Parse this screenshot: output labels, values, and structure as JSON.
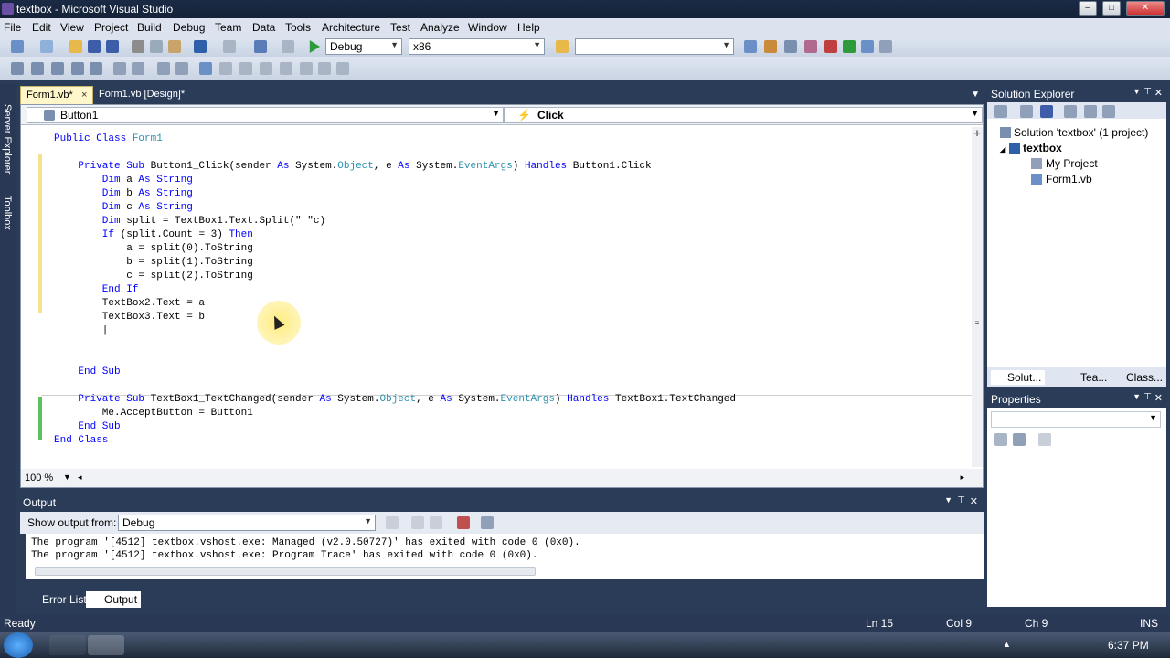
{
  "window": {
    "title": "textbox - Microsoft Visual Studio"
  },
  "menu": [
    "File",
    "Edit",
    "View",
    "Project",
    "Build",
    "Debug",
    "Team",
    "Data",
    "Tools",
    "Architecture",
    "Test",
    "Analyze",
    "Window",
    "Help"
  ],
  "toolbar": {
    "config": "Debug",
    "platform": "x86",
    "find_value": ""
  },
  "left_rail": {
    "server_explorer": "Server Explorer",
    "toolbox": "Toolbox"
  },
  "doc_tabs": [
    {
      "label": "Form1.vb*",
      "close": "×"
    },
    {
      "label": "Form1.vb [Design]*"
    }
  ],
  "editor": {
    "nav_left": "Button1",
    "nav_right": "Click",
    "zoom": "100 %",
    "lines": [
      {
        "tokens": [
          {
            "t": "Public Class ",
            "k": "kw"
          },
          {
            "t": "Form1",
            "k": "ty"
          }
        ]
      },
      {
        "tokens": [
          {
            "t": "    Private Sub ",
            "k": "kw"
          },
          {
            "t": "Button1_Click(sender "
          },
          {
            "t": "As ",
            "k": "kw"
          },
          {
            "t": "System."
          },
          {
            "t": "Object",
            "k": "ty"
          },
          {
            "t": ", e "
          },
          {
            "t": "As ",
            "k": "kw"
          },
          {
            "t": "System."
          },
          {
            "t": "EventArgs",
            "k": "ty"
          },
          {
            "t": ") "
          },
          {
            "t": "Handles ",
            "k": "kw"
          },
          {
            "t": "Button1.Click"
          }
        ]
      },
      {
        "tokens": [
          {
            "t": "        Dim ",
            "k": "kw"
          },
          {
            "t": "a "
          },
          {
            "t": "As String",
            "k": "kw"
          }
        ]
      },
      {
        "tokens": [
          {
            "t": "        Dim ",
            "k": "kw"
          },
          {
            "t": "b "
          },
          {
            "t": "As String",
            "k": "kw"
          }
        ]
      },
      {
        "tokens": [
          {
            "t": "        Dim ",
            "k": "kw"
          },
          {
            "t": "c "
          },
          {
            "t": "As String",
            "k": "kw"
          }
        ]
      },
      {
        "tokens": [
          {
            "t": "        Dim ",
            "k": "kw"
          },
          {
            "t": "split = TextBox1.Text.Split(\" \"c)"
          }
        ]
      },
      {
        "tokens": [
          {
            "t": "        If ",
            "k": "kw"
          },
          {
            "t": "(split.Count = 3) "
          },
          {
            "t": "Then",
            "k": "kw"
          }
        ]
      },
      {
        "tokens": [
          {
            "t": "            a = split(0).ToString"
          }
        ]
      },
      {
        "tokens": [
          {
            "t": "            b = split(1).ToString"
          }
        ]
      },
      {
        "tokens": [
          {
            "t": "            c = split(2).ToString"
          }
        ]
      },
      {
        "tokens": [
          {
            "t": "        End If",
            "k": "kw"
          }
        ]
      },
      {
        "tokens": [
          {
            "t": "        TextBox2.Text = a"
          }
        ]
      },
      {
        "tokens": [
          {
            "t": "        TextBox3.Text = b"
          }
        ]
      },
      {
        "tokens": [
          {
            "t": "        |"
          }
        ]
      },
      {
        "tokens": [
          {
            "t": "    End Sub",
            "k": "kw"
          }
        ]
      },
      {
        "tokens": [
          {
            "t": "    Private Sub ",
            "k": "kw"
          },
          {
            "t": "TextBox1_TextChanged(sender "
          },
          {
            "t": "As ",
            "k": "kw"
          },
          {
            "t": "System."
          },
          {
            "t": "Object",
            "k": "ty"
          },
          {
            "t": ", e "
          },
          {
            "t": "As ",
            "k": "kw"
          },
          {
            "t": "System."
          },
          {
            "t": "EventArgs",
            "k": "ty"
          },
          {
            "t": ") "
          },
          {
            "t": "Handles ",
            "k": "kw"
          },
          {
            "t": "TextBox1.TextChanged"
          }
        ]
      },
      {
        "tokens": [
          {
            "t": "        Me.AcceptButton = Button1"
          }
        ]
      },
      {
        "tokens": [
          {
            "t": "    End Sub",
            "k": "kw"
          }
        ]
      },
      {
        "tokens": [
          {
            "t": "End Class",
            "k": "kw"
          }
        ]
      }
    ]
  },
  "solution_explorer": {
    "title": "Solution Explorer",
    "solution": "Solution 'textbox' (1 project)",
    "project": "textbox",
    "items": [
      "My Project",
      "Form1.vb"
    ],
    "tabs": [
      "Solut...",
      "Tea...",
      "Class..."
    ]
  },
  "properties": {
    "title": "Properties"
  },
  "output": {
    "title": "Output",
    "show_from_label": "Show output from:",
    "show_from_value": "Debug",
    "lines": [
      "The program '[4512] textbox.vshost.exe: Managed (v2.0.50727)' has exited with code 0 (0x0).",
      "The program '[4512] textbox.vshost.exe: Program Trace' has exited with code 0 (0x0)."
    ]
  },
  "bottom_tabs": [
    "Error List",
    "Output"
  ],
  "status": {
    "left": "Ready",
    "ln": "Ln 15",
    "col": "Col 9",
    "ch": "Ch 9",
    "mode": "INS"
  },
  "taskbar": {
    "clock": "6:37 PM"
  },
  "colors": {
    "keyword": "#0000ff",
    "type": "#2b91af",
    "chrome": "#293955"
  }
}
